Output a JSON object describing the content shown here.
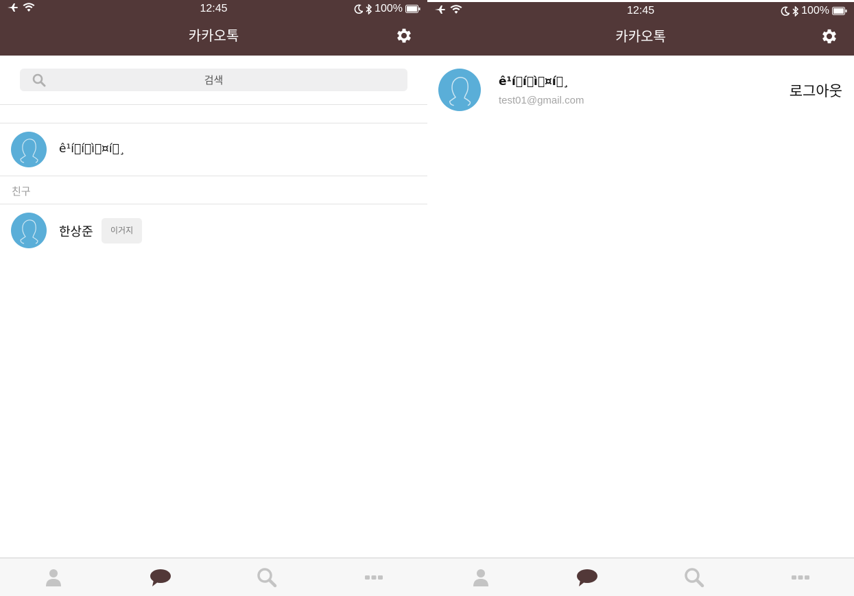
{
  "status": {
    "time": "12:45",
    "battery": "100%"
  },
  "app": {
    "title": "카카오톡"
  },
  "search": {
    "placeholder": "검색"
  },
  "me": {
    "name": "ê¹í\u0000í\u0000ì\u0000¤í\u0000¸"
  },
  "friends": {
    "section_label": "친구",
    "items": [
      {
        "name": "한상준",
        "status": "이거지"
      }
    ]
  },
  "profile": {
    "name": "ê¹í\u0000í\u0000ì\u0000¤í\u0000¸",
    "email": "test01@gmail.com",
    "logout_label": "로그아웃"
  },
  "tabs": [
    {
      "icon": "person-icon",
      "color": "#c4c4c4"
    },
    {
      "icon": "chat-bubble-icon",
      "color": "#523838"
    },
    {
      "icon": "search-icon",
      "color": "#c4c4c4"
    },
    {
      "icon": "more-icon",
      "color": "#c4c4c4"
    }
  ],
  "colors": {
    "header": "#523838",
    "avatar": "#5aaed8",
    "tab_active": "#523838",
    "tab_inactive": "#c4c4c4"
  }
}
